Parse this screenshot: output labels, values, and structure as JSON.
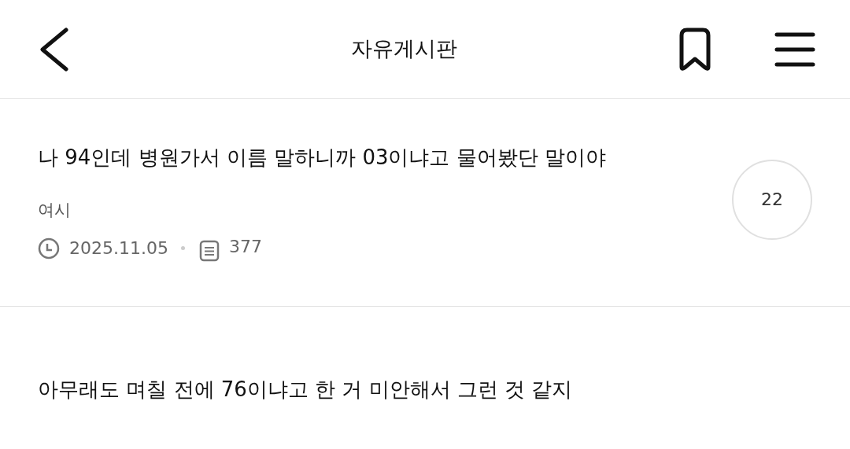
{
  "header": {
    "title": "자유게시판"
  },
  "post": {
    "title": "나 94인데 병원가서 이름 말하니까 03이냐고 물어봤단 말이야",
    "author": "여시",
    "date": "2025.11.05",
    "views": "377",
    "comments": "22"
  },
  "body": {
    "text": "아무래도 며칠 전에 76이냐고 한 거 미안해서 그런 것 같지"
  }
}
